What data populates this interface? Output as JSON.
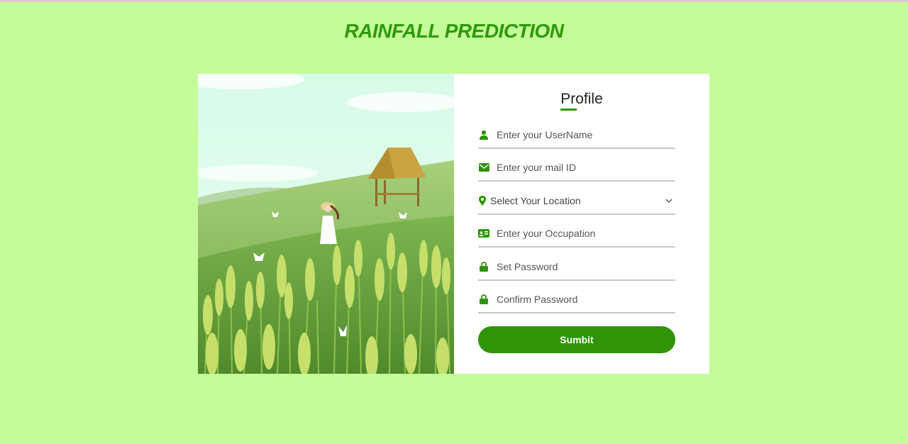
{
  "header": {
    "title": "RAINFALL PREDICTION"
  },
  "form": {
    "title": "Profile",
    "fields": [
      {
        "icon": "user-icon",
        "placeholder": "Enter your UserName",
        "value": ""
      },
      {
        "icon": "envelope-icon",
        "placeholder": "Enter your mail ID",
        "value": ""
      },
      {
        "icon": "map-marker-icon",
        "selected": "Select Your Location"
      },
      {
        "icon": "id-card-icon",
        "placeholder": "Enter your Occupation",
        "value": ""
      },
      {
        "icon": "lock-icon",
        "placeholder": "Set Password",
        "value": ""
      },
      {
        "icon": "lock-icon",
        "placeholder": "Confirm Password",
        "value": ""
      }
    ],
    "submit_label": "Sumbit"
  },
  "colors": {
    "background": "#c5fc9a",
    "accent": "#2f9407",
    "title": "#2e9a0a"
  },
  "illustration": {
    "description_icon": "wheat-field-illustration"
  }
}
